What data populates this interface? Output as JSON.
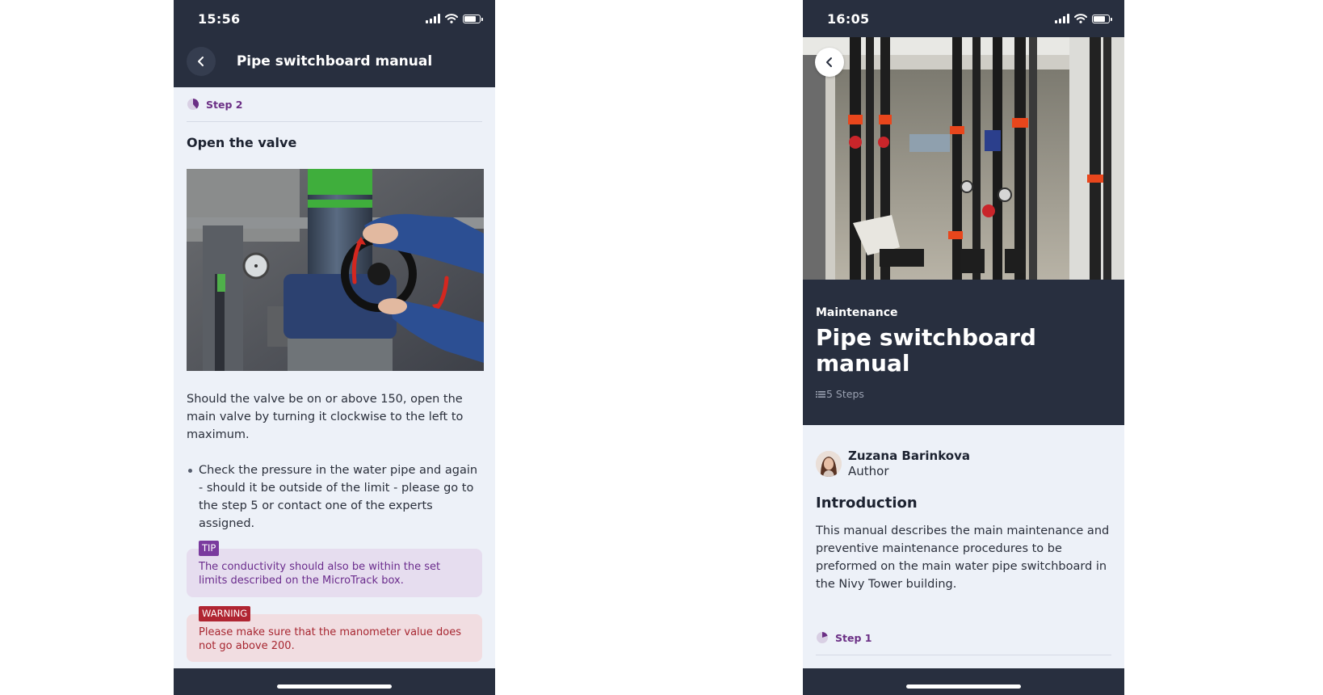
{
  "left_screen": {
    "status_time": "15:56",
    "header_title": "Pipe switchboard manual",
    "step_label": "Step 2",
    "section_title": "Open the valve",
    "body_text": "Should the valve be on or above 150, open the main valve by turning it clockwise to the left to maximum.",
    "bullet_text": "Check the pressure in the water pipe and again - should it be outside of the limit - please go to the step 5 or contact one of the experts assigned.",
    "tip_badge": "TIP",
    "tip_text": "The conductivity should also be within the set limits described on the MicroTrack box.",
    "warning_badge": "WARNING",
    "warning_text": "Please make sure that the manometer value does not go above 200."
  },
  "right_screen": {
    "status_time": "16:05",
    "category": "Maintenance",
    "manual_title": "Pipe switchboard manual",
    "steps_count": "5 Steps",
    "author_name": "Zuzana Barinkova",
    "author_role": "Author",
    "section_title": "Introduction",
    "intro_text": "This manual describes the main maintenance and preventive maintenance procedures to be preformed on the main water pipe switchboard in the Nivy Tower building.",
    "step_label": "Step 1"
  },
  "icons": {
    "back": "chevron-left-icon",
    "signal": "cellular-signal-icon",
    "wifi": "wifi-icon",
    "battery": "battery-icon",
    "step": "step-progress-icon",
    "list": "list-icon"
  },
  "battery_level": 0.8,
  "colors": {
    "header_bg": "#282f3f",
    "content_bg": "#edf1f8",
    "accent_purple": "#6b2f85",
    "tip_bg": "#e6ddef",
    "tip_badge": "#7a3a9e",
    "warning_bg": "#f1dde1",
    "warning_badge": "#b02532"
  }
}
